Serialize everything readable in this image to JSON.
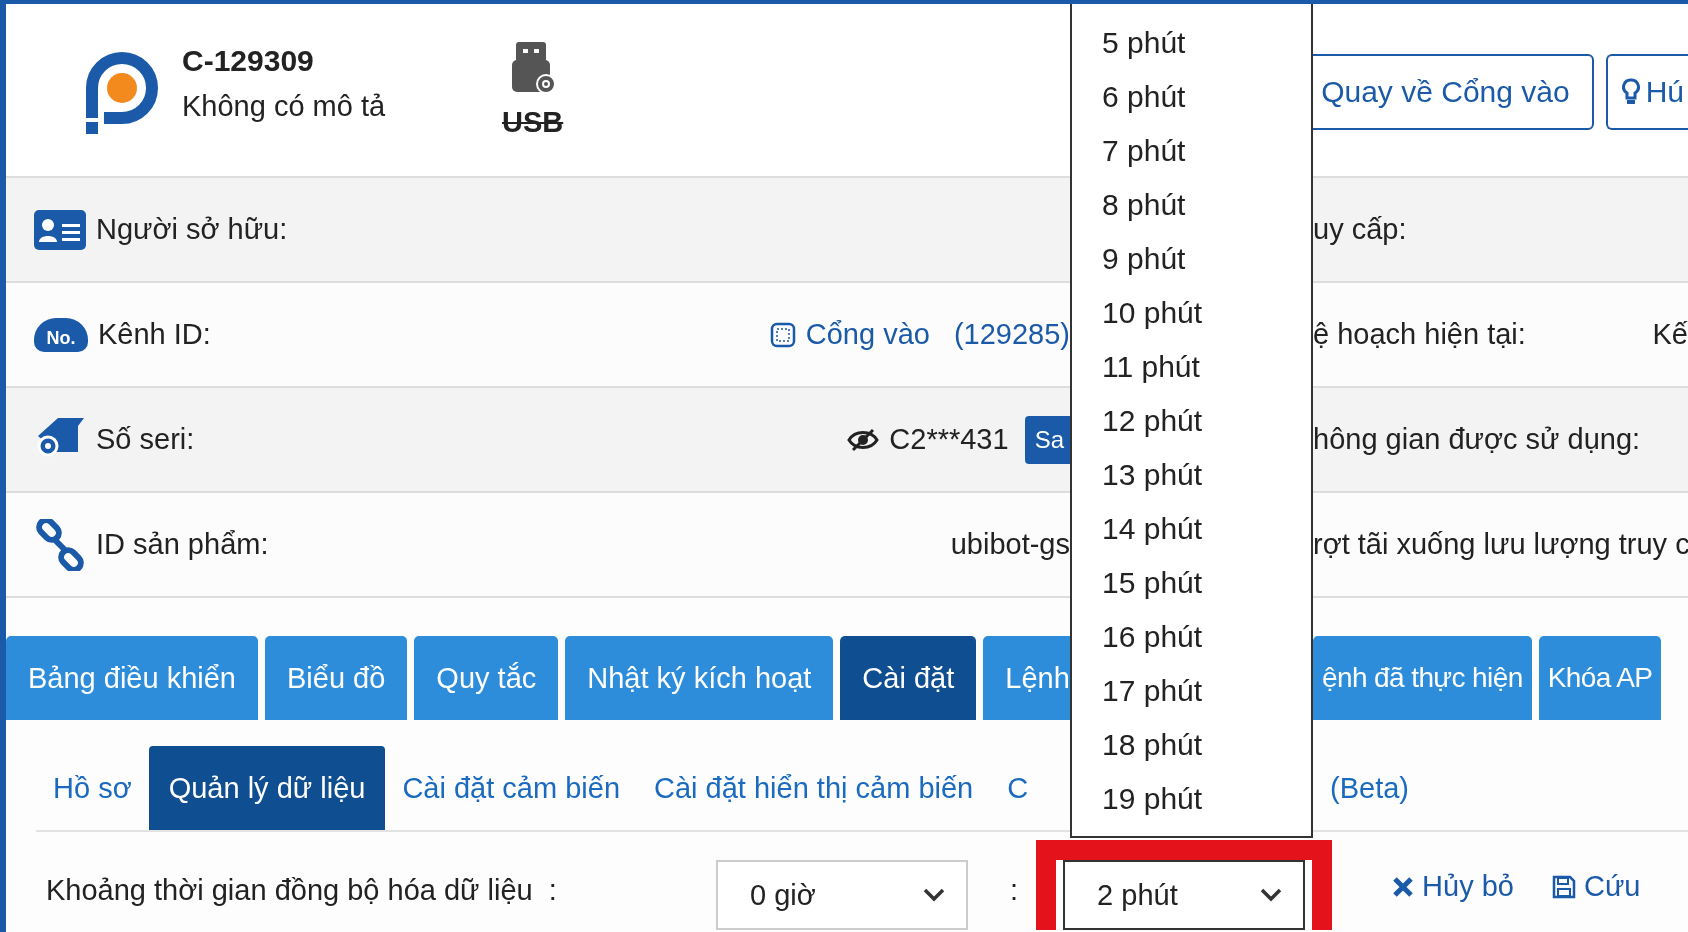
{
  "header": {
    "device_id": "C-129309",
    "description": "Không có mô tả",
    "connection": {
      "label": "USB",
      "available": false
    },
    "buttons": [
      {
        "label": "Quay về Cổng vào",
        "kind": "back"
      },
      {
        "label": "Hú",
        "kind": "hint"
      }
    ]
  },
  "info_rows": [
    {
      "kind": "owner",
      "label": "Người sở hữu:",
      "right_label": "uy cấp:"
    },
    {
      "kind": "channel",
      "icon_text": "No.",
      "label": "Kênh ID:",
      "value": "Cổng vào",
      "value_extra": "(129285)",
      "right_label": "ệ hoạch hiện tại:",
      "right_value": "Kế"
    },
    {
      "kind": "serial",
      "label": "Số seri:",
      "value": "C2***431",
      "button": "Sa",
      "right_label": "hông gian được sử dụng:"
    },
    {
      "kind": "product",
      "label": "ID sản phẩm:",
      "value": "ubibot-gs",
      "right_label": "rợt tãi xuống lưu lượng truy c"
    }
  ],
  "tabs": {
    "before_dropdown": [
      {
        "label": "Bảng điều khiển",
        "selected": false
      },
      {
        "label": "Biểu đồ",
        "selected": false
      },
      {
        "label": "Quy tắc",
        "selected": false
      },
      {
        "label": "Nhật ký kích hoạt",
        "selected": false
      },
      {
        "label": "Cài đặt",
        "selected": true
      },
      {
        "label": "Lệnh",
        "selected": false
      }
    ],
    "after_dropdown": [
      {
        "label": "ệnh đã thực hiện",
        "selected": false
      },
      {
        "label": "Khóa AP",
        "selected": false
      }
    ]
  },
  "subtabs": {
    "before_dropdown": [
      {
        "label": "Hồ sơ",
        "selected": false
      },
      {
        "label": "Quản lý dữ liệu",
        "selected": true
      },
      {
        "label": "Cài đặt cảm biến",
        "selected": false
      },
      {
        "label": "Cài đặt hiển thị cảm biến",
        "selected": false
      },
      {
        "label": "C",
        "selected": false
      }
    ],
    "after_dropdown": [
      {
        "label": "(Beta)",
        "selected": false
      }
    ]
  },
  "sync": {
    "label": "Khoảng thời gian đồng bộ hóa dữ liệu  :",
    "hours": "0 giờ",
    "separator": ":",
    "minutes": "2 phút",
    "highlighted": true,
    "cancel": "Hủy bỏ",
    "save": "Cứu"
  },
  "minute_options": [
    "5 phút",
    "6 phút",
    "7 phút",
    "8 phút",
    "9 phút",
    "10 phút",
    "11 phút",
    "12 phút",
    "13 phút",
    "14 phút",
    "15 phút",
    "16 phút",
    "17 phút",
    "18 phút",
    "19 phút"
  ]
}
